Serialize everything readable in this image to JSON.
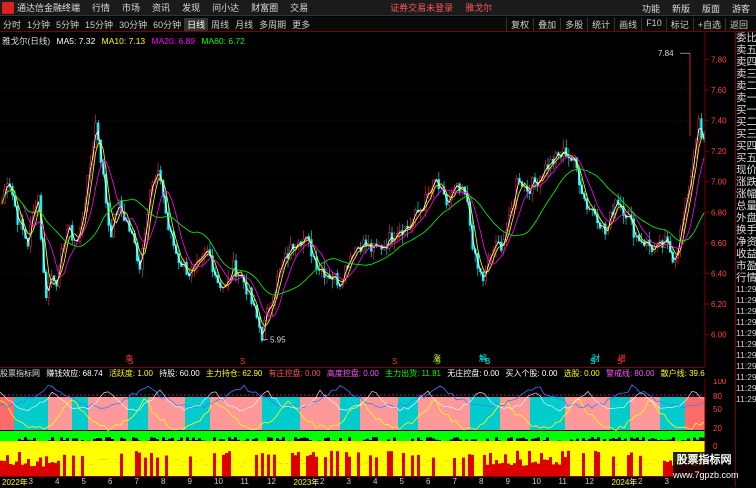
{
  "menubar": {
    "app_title": "通达信金融终端",
    "menus": [
      "行情",
      "市场",
      "资讯",
      "发现",
      "问小达",
      "财富圈",
      "交易"
    ],
    "notice": "证券交易未登录",
    "stock_tag": "雅戈尔",
    "right": [
      "功能",
      "新版",
      "版面",
      "游客"
    ]
  },
  "toolbar": {
    "periods": [
      "分时",
      "1分钟",
      "5分钟",
      "15分钟",
      "30分钟",
      "60分钟",
      "日线",
      "周线",
      "月线",
      "多周期",
      "更多"
    ],
    "active": "日线",
    "tools": [
      "复权",
      "叠加",
      "多股",
      "统计",
      "画线",
      "F10",
      "标记",
      "+自选",
      "返回"
    ]
  },
  "title": {
    "stock": "雅戈尔(日线)",
    "ma5": "MA5: 7.32",
    "ma10": "MA10: 7.13",
    "ma20": "MA20: 6.89",
    "ma60": "MA60: 6.72"
  },
  "colors": {
    "ma5": "#ffffff",
    "ma10": "#ffff00",
    "ma20": "#ff00ff",
    "ma60": "#00ff00",
    "up": "#ff3333",
    "down": "#00ffff"
  },
  "chart_data": {
    "type": "candlestick",
    "y_ticks": [
      "7.80",
      "7.60",
      "7.40",
      "7.20",
      "7.00",
      "6.80",
      "6.60",
      "6.40",
      "6.20",
      "6.00"
    ],
    "ylim": [
      5.9,
      7.9
    ],
    "annotations": {
      "high": "7.84",
      "low": "5.95"
    },
    "markers": [
      "S",
      "S",
      "S",
      "S",
      "B",
      "S",
      "S"
    ],
    "subchart_y_ticks": [
      "100",
      "80",
      "50",
      "20",
      "0"
    ]
  },
  "subhdr": {
    "items": [
      {
        "t": "股票指标网",
        "c": "#ddd"
      },
      {
        "t": "赚钱效应: 68.74",
        "c": "#fff"
      },
      {
        "t": "活跃度: 1.00",
        "c": "#ffff00"
      },
      {
        "t": "持股: 60.00",
        "c": "#fff"
      },
      {
        "t": "主力持仓: 62.90",
        "c": "#ffff00"
      },
      {
        "t": "有庄控盘: 0.00",
        "c": "#ff5555"
      },
      {
        "t": "高度控盘: 0.00",
        "c": "#ff55ff"
      },
      {
        "t": "主力出货: 11.81",
        "c": "#00ff00"
      },
      {
        "t": "无庄控盘: 0.00",
        "c": "#fff"
      },
      {
        "t": "买入个股: 0.00",
        "c": "#fff"
      },
      {
        "t": "选股: 0.00",
        "c": "#ffff00"
      },
      {
        "t": "警戒线: 80.00",
        "c": "#ff55ff"
      },
      {
        "t": "散户线: 39.61",
        "c": "#ffff00"
      }
    ]
  },
  "markers_text": {
    "m1": "卖",
    "m2": "涨",
    "m3": "解",
    "m4": "财",
    "m5": "增"
  },
  "right_panel": {
    "labels": [
      "委比",
      "卖五",
      "卖四",
      "卖三",
      "卖二",
      "卖一",
      "买一",
      "买二",
      "买三",
      "买四",
      "买五",
      "现价",
      "涨跌",
      "涨幅",
      "总量",
      "外盘",
      "换手",
      "净资",
      "收益",
      "市盈",
      "行情"
    ],
    "times": [
      "11:29",
      "11:29",
      "11:29",
      "11:29",
      "11:29",
      "11:29",
      "11:29",
      "11:29",
      "11:29",
      "11:29",
      "11:29"
    ]
  },
  "xaxis": {
    "labels": [
      "2022年",
      "3",
      "4",
      "5",
      "6",
      "7",
      "8",
      "9",
      "10",
      "11",
      "12",
      "2023年",
      "2",
      "3",
      "4",
      "5",
      "6",
      "7",
      "8",
      "9",
      "10",
      "11",
      "12",
      "2024年",
      "2",
      "3"
    ]
  },
  "watermark": {
    "line1": "股票指标网",
    "line2": "www.7gpzb.com"
  }
}
